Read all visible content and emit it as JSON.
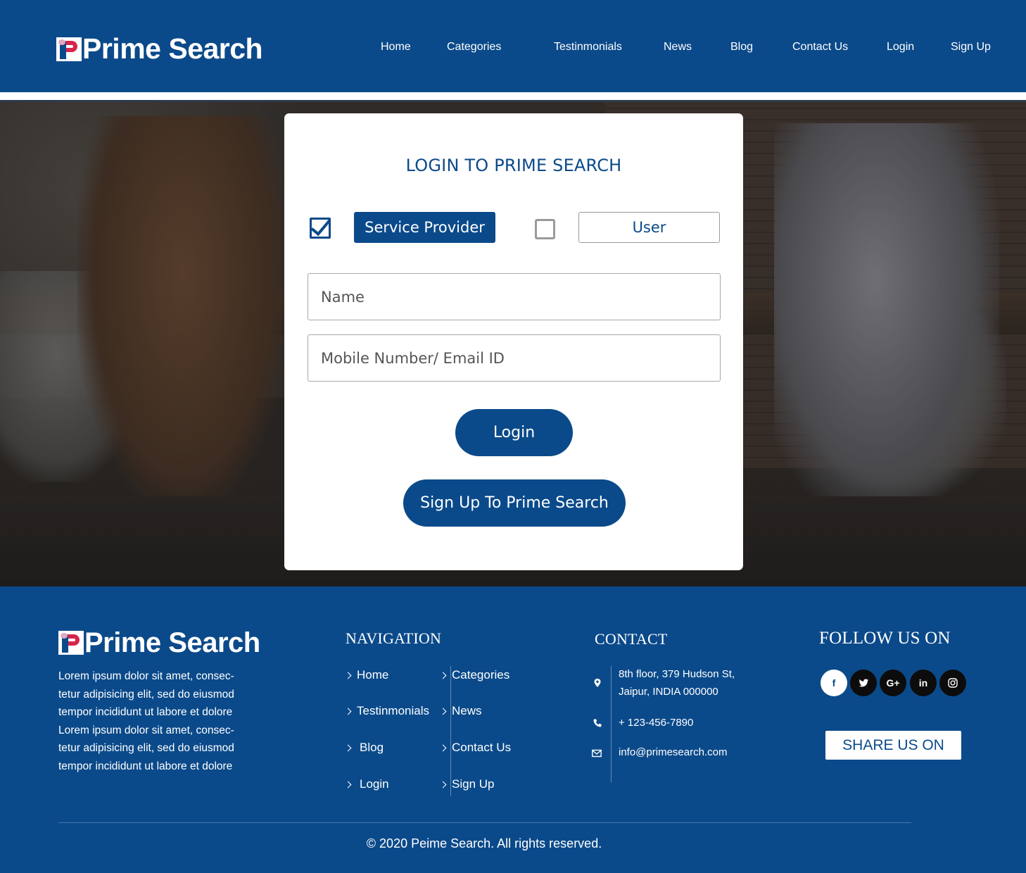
{
  "brand": {
    "name": "Prime Search",
    "primary_color": "#0b4a8a",
    "accent_color": "#d6254a"
  },
  "header": {
    "nav": [
      {
        "label": "Home"
      },
      {
        "label": "Categories"
      },
      {
        "label": "Testinmonials"
      },
      {
        "label": "News"
      },
      {
        "label": "Blog"
      },
      {
        "label": "Contact Us"
      },
      {
        "label": "Login"
      },
      {
        "label": "Sign Up"
      }
    ]
  },
  "login_card": {
    "title": "LOGIN TO PRIME SEARCH",
    "roles": [
      {
        "label": "Service Provider",
        "checked": true
      },
      {
        "label": "User",
        "checked": false
      }
    ],
    "name_placeholder": "Name",
    "contact_placeholder": "Mobile Number/ Email ID",
    "login_label": "Login",
    "signup_label": "Sign Up To Prime Search"
  },
  "footer": {
    "about": "Lorem ipsum dolor sit amet, consec-tetur adipisicing elit, sed do eiusmod tempor incididunt ut labore et dolore Lorem ipsum dolor sit amet, consec-tetur adipisicing elit, sed do eiusmod tempor incididunt ut labore et dolore",
    "about_lines": [
      "Lorem ipsum dolor sit amet, consec-",
      "tetur adipisicing elit, sed do eiusmod",
      "tempor incididunt ut labore et dolore",
      "Lorem ipsum dolor sit amet, consec-",
      "tetur adipisicing elit, sed do eiusmod",
      "tempor incididunt ut labore et dolore"
    ],
    "navigation_heading": "NAVIGATION",
    "navigation": [
      {
        "label": "Home"
      },
      {
        "label": "Categories"
      },
      {
        "label": "Testinmonials"
      },
      {
        "label": "News"
      },
      {
        "label": "Blog"
      },
      {
        "label": "Contact Us"
      },
      {
        "label": "Login"
      },
      {
        "label": "Sign Up"
      }
    ],
    "contact_heading": "CONTACT",
    "contact": {
      "address_line1": "8th floor, 379 Hudson St,",
      "address_line2": "Jaipur, INDIA 000000",
      "phone": "+ 123-456-7890",
      "email": "info@primesearch.com"
    },
    "follow_heading": "FOLLOW US ON",
    "social": [
      {
        "icon": "facebook-icon",
        "glyph": "f"
      },
      {
        "icon": "twitter-icon",
        "glyph": "t"
      },
      {
        "icon": "google-plus-icon",
        "glyph": "G+"
      },
      {
        "icon": "linkedin-icon",
        "glyph": "in"
      },
      {
        "icon": "instagram-icon",
        "glyph": "ig"
      }
    ],
    "share_label": "SHARE US ON",
    "copyright": "© 2020  Peime Search. All rights reserved."
  }
}
